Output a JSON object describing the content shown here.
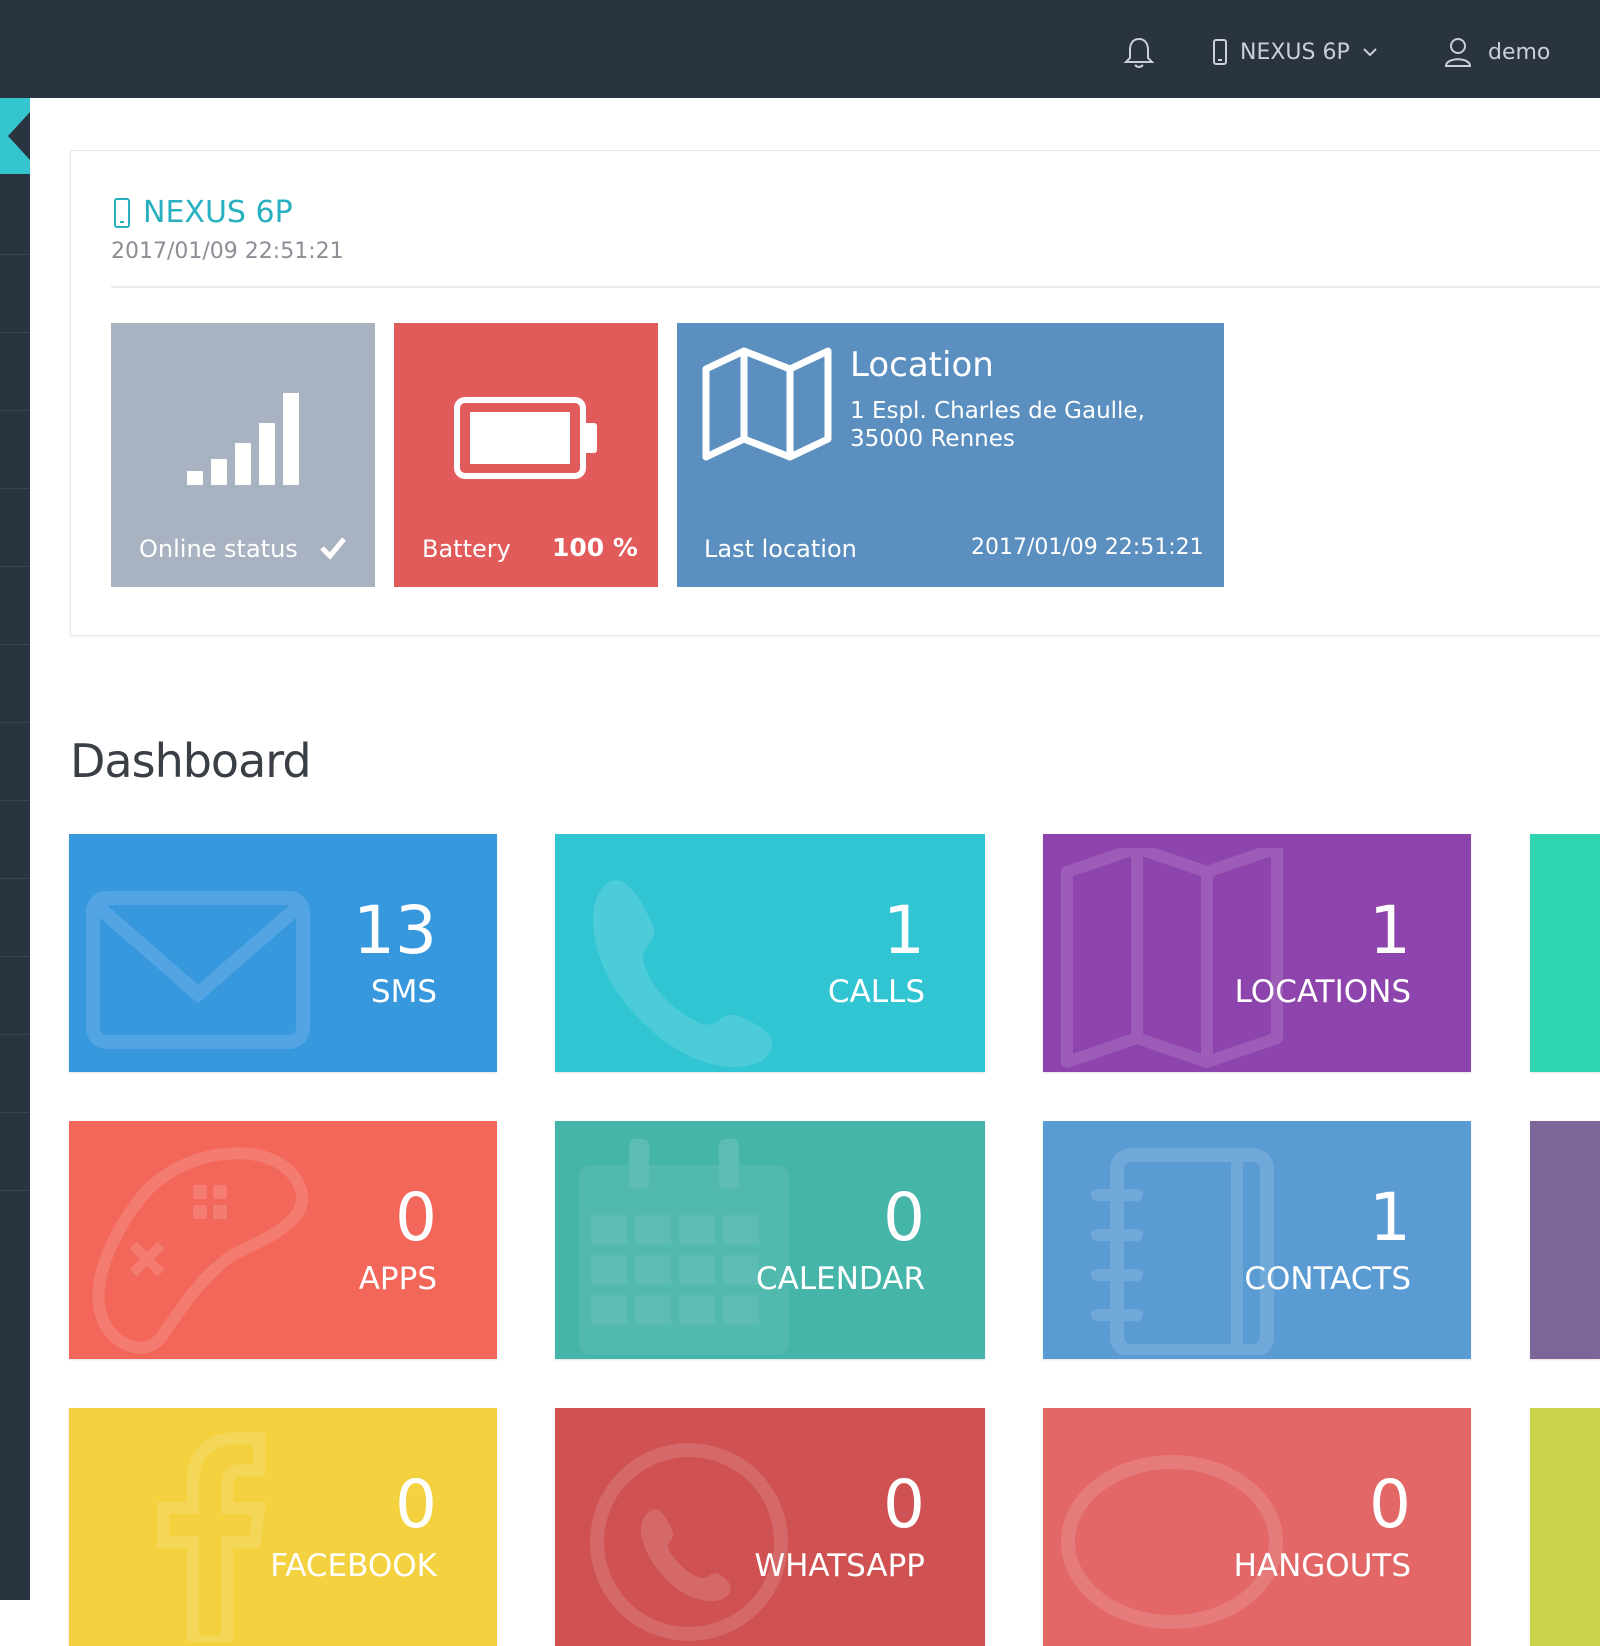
{
  "topbar": {
    "device_label": "NEXUS 6P",
    "user_label": "demo"
  },
  "device": {
    "name": "NEXUS 6P",
    "updated": "2017/01/09 22:51:21",
    "online": {
      "label": "Online status"
    },
    "battery": {
      "label": "Battery",
      "value": "100 %"
    },
    "location": {
      "heading": "Location",
      "address": "1 Espl. Charles de Gaulle, 35000 Rennes",
      "label": "Last location",
      "date": "2017/01/09 22:51:21"
    }
  },
  "dashboard": {
    "title": "Dashboard",
    "tiles": [
      {
        "count": "13",
        "label": "SMS",
        "icon": "envelope-icon",
        "color": "#3898de"
      },
      {
        "count": "1",
        "label": "CALLS",
        "icon": "phone-icon",
        "color": "#31c4d3"
      },
      {
        "count": "1",
        "label": "LOCATIONS",
        "icon": "map-icon",
        "color": "#8e44ad"
      },
      {
        "count": "0",
        "label": "APPS",
        "icon": "gamepad-icon",
        "color": "#f2675a"
      },
      {
        "count": "0",
        "label": "CALENDAR",
        "icon": "calendar-icon",
        "color": "#45b4a9"
      },
      {
        "count": "1",
        "label": "CONTACTS",
        "icon": "address-book-icon",
        "color": "#5b9bd4"
      },
      {
        "count": "0",
        "label": "FACEBOOK",
        "icon": "facebook-icon",
        "color": "#f3d13f"
      },
      {
        "count": "0",
        "label": "WHATSAPP",
        "icon": "whatsapp-icon",
        "color": "#cf5151"
      },
      {
        "count": "0",
        "label": "HANGOUTS",
        "icon": "hangouts-icon",
        "color": "#e36767"
      }
    ],
    "edge_colors": [
      "#2fd5b1",
      "#7c6598",
      "#c9d44b"
    ]
  }
}
